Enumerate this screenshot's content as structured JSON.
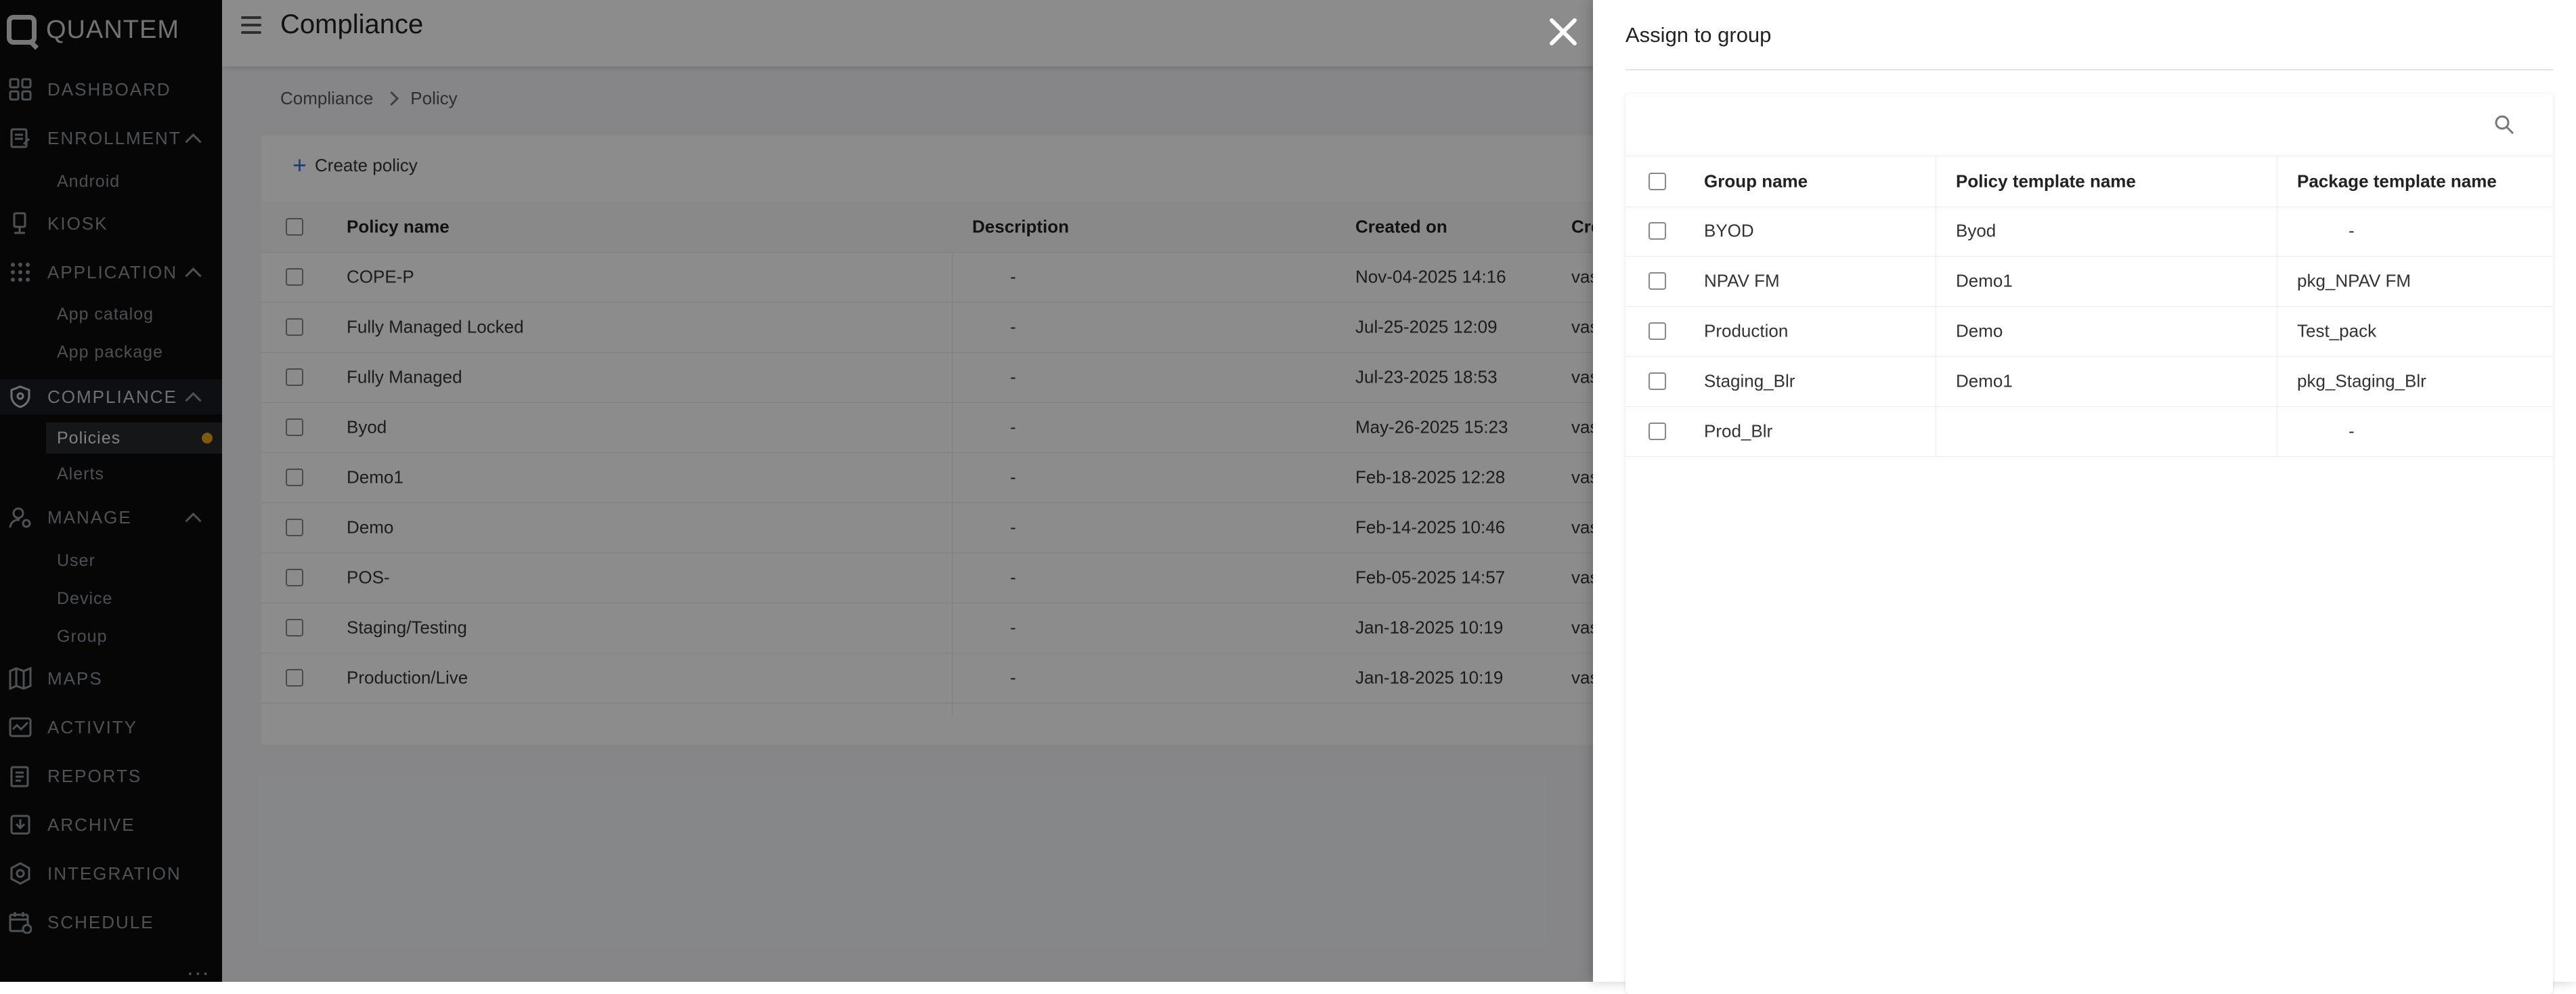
{
  "brand": {
    "name": "QUANTEM"
  },
  "sidebar": {
    "items": [
      {
        "label": "DASHBOARD",
        "icon": "grid-icon"
      },
      {
        "label": "ENROLLMENT",
        "icon": "enrollment-icon",
        "children": [
          "Android"
        ]
      },
      {
        "label": "KIOSK",
        "icon": "kiosk-icon"
      },
      {
        "label": "APPLICATION",
        "icon": "apps-icon",
        "children": [
          "App catalog",
          "App package"
        ]
      },
      {
        "label": "COMPLIANCE",
        "icon": "shield-icon",
        "children": [
          "Policies",
          "Alerts"
        ]
      },
      {
        "label": "MANAGE",
        "icon": "user-icon",
        "children": [
          "User",
          "Device",
          "Group"
        ]
      },
      {
        "label": "MAPS",
        "icon": "map-icon"
      },
      {
        "label": "ACTIVITY",
        "icon": "activity-icon"
      },
      {
        "label": "REPORTS",
        "icon": "reports-icon"
      },
      {
        "label": "ARCHIVE",
        "icon": "archive-icon"
      },
      {
        "label": "INTEGRATION",
        "icon": "integration-icon"
      },
      {
        "label": "SCHEDULE",
        "icon": "schedule-icon"
      }
    ],
    "more": "..."
  },
  "header": {
    "title": "Compliance"
  },
  "breadcrumb": [
    "Compliance",
    "Policy"
  ],
  "policies": {
    "create_label": "Create policy",
    "columns": [
      "Policy name",
      "Description",
      "Created on",
      "Created"
    ],
    "rows": [
      {
        "name": "COPE-P",
        "description": "-",
        "created_on": "Nov-04-2025 14:16",
        "created_by": "vasu@q"
      },
      {
        "name": "Fully Managed Locked",
        "description": "-",
        "created_on": "Jul-25-2025 12:09",
        "created_by": "vasu@q"
      },
      {
        "name": "Fully Managed",
        "description": "-",
        "created_on": "Jul-23-2025 18:53",
        "created_by": "vasu@q"
      },
      {
        "name": "Byod",
        "description": "-",
        "created_on": "May-26-2025 15:23",
        "created_by": "vasu@q"
      },
      {
        "name": "Demo1",
        "description": "-",
        "created_on": "Feb-18-2025 12:28",
        "created_by": "vasu@q"
      },
      {
        "name": "Demo",
        "description": "-",
        "created_on": "Feb-14-2025 10:46",
        "created_by": "vasu@q"
      },
      {
        "name": "POS-",
        "description": "-",
        "created_on": "Feb-05-2025 14:57",
        "created_by": "vasu@q"
      },
      {
        "name": "Staging/Testing",
        "description": "-",
        "created_on": "Jan-18-2025 10:19",
        "created_by": "vasu@q"
      },
      {
        "name": "Production/Live",
        "description": "-",
        "created_on": "Jan-18-2025 10:19",
        "created_by": "vasu@q"
      }
    ]
  },
  "drawer": {
    "title": "Assign to group",
    "columns": [
      "Group name",
      "Policy template name",
      "Package template name"
    ],
    "rows": [
      {
        "group": "BYOD",
        "policy": "Byod",
        "package": "-"
      },
      {
        "group": "NPAV FM",
        "policy": "Demo1",
        "package": "pkg_NPAV FM"
      },
      {
        "group": "Production",
        "policy": "Demo",
        "package": "Test_pack"
      },
      {
        "group": "Staging_Blr",
        "policy": "Demo1",
        "package": "pkg_Staging_Blr"
      },
      {
        "group": "Prod_Blr",
        "policy": "",
        "package": "-"
      }
    ]
  },
  "colors": {
    "accent": "#2f6fdb",
    "badge": "#e6a21c",
    "sidebar_bg": "#0b0c0e"
  }
}
